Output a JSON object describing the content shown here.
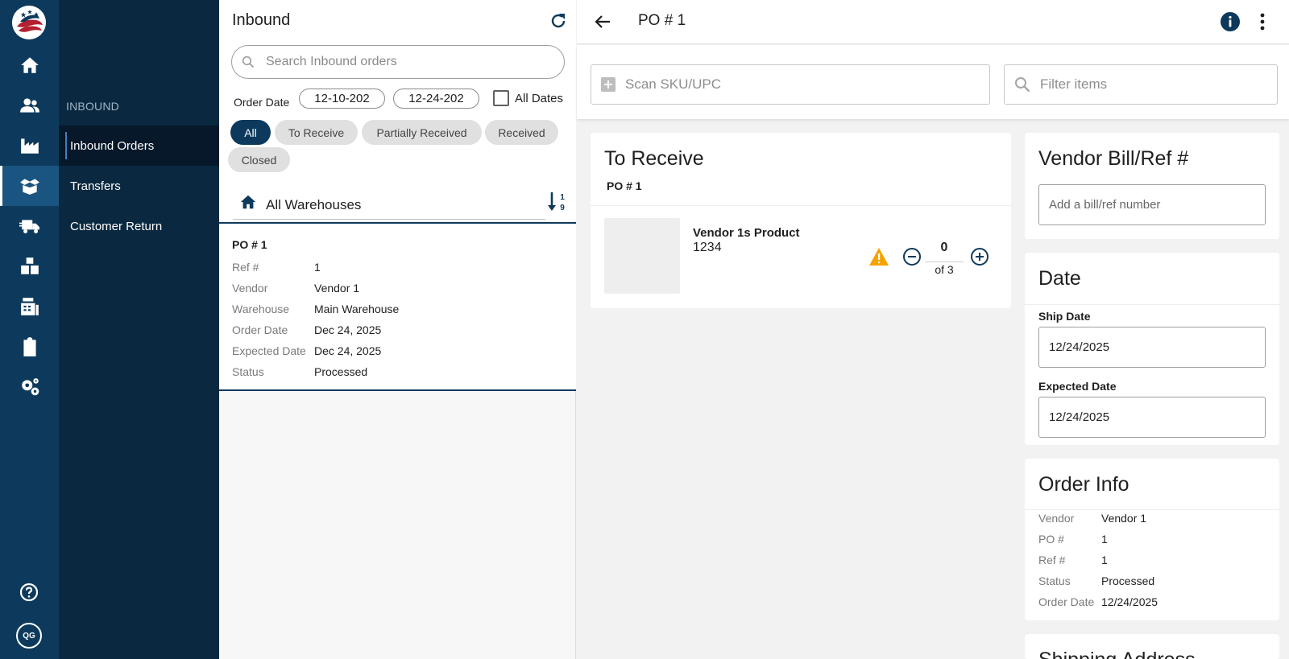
{
  "rail": {
    "items": [
      {
        "name": "home",
        "active": false
      },
      {
        "name": "customers",
        "active": false
      },
      {
        "name": "reports",
        "active": false
      },
      {
        "name": "inbound",
        "active": true
      },
      {
        "name": "shipping",
        "active": false
      },
      {
        "name": "inventory",
        "active": false
      },
      {
        "name": "billing",
        "active": false
      },
      {
        "name": "tasks",
        "active": false
      },
      {
        "name": "settings",
        "active": false
      }
    ],
    "avatar_initials": "QG",
    "active_color": "#1a5480",
    "bg_color": "#0d3a5c"
  },
  "subnav": {
    "section_label": "INBOUND",
    "items": [
      {
        "label": "Inbound Orders",
        "active": true
      },
      {
        "label": "Transfers",
        "active": false
      },
      {
        "label": "Customer Return",
        "active": false
      }
    ]
  },
  "list": {
    "title": "Inbound",
    "search_placeholder": "Search Inbound orders",
    "date_label": "Order Date",
    "date_from": "12-10-202",
    "date_to": "12-24-202",
    "all_dates_label": "All Dates",
    "all_dates_checked": false,
    "filters": [
      {
        "label": "All",
        "active": true
      },
      {
        "label": "To Receive",
        "active": false
      },
      {
        "label": "Partially Received",
        "active": false
      },
      {
        "label": "Received",
        "active": false
      },
      {
        "label": "Closed",
        "active": false
      }
    ],
    "warehouse_label": "All Warehouses",
    "orders": [
      {
        "po": "PO # 1",
        "fields": [
          {
            "k": "Ref #",
            "v": "1"
          },
          {
            "k": "Vendor",
            "v": "Vendor 1"
          },
          {
            "k": "Warehouse",
            "v": "Main Warehouse"
          },
          {
            "k": "Order Date",
            "v": "Dec 24, 2025"
          },
          {
            "k": "Expected Date",
            "v": "Dec 24, 2025"
          },
          {
            "k": "Status",
            "v": "Processed"
          }
        ]
      }
    ]
  },
  "detail": {
    "title": "PO # 1",
    "scan_placeholder": "Scan SKU/UPC",
    "filter_placeholder": "Filter items",
    "receive": {
      "title": "To Receive",
      "po": "PO # 1",
      "items": [
        {
          "name": "Vendor 1s Product",
          "sku": "1234",
          "qty": "0",
          "of": "of 3",
          "warning": true
        }
      ]
    },
    "vendor_bill": {
      "title": "Vendor Bill/Ref #",
      "placeholder": "Add a bill/ref number",
      "value": ""
    },
    "date": {
      "title": "Date",
      "ship_label": "Ship Date",
      "ship_value": "12/24/2025",
      "expected_label": "Expected Date",
      "expected_value": "12/24/2025"
    },
    "order_info": {
      "title": "Order Info",
      "fields": [
        {
          "k": "Vendor",
          "v": "Vendor 1"
        },
        {
          "k": "PO #",
          "v": "1"
        },
        {
          "k": "Ref #",
          "v": "1"
        },
        {
          "k": "Status",
          "v": "Processed"
        },
        {
          "k": "Order Date",
          "v": "12/24/2025"
        }
      ]
    },
    "shipping_address": {
      "title": "Shipping Address"
    }
  },
  "colors": {
    "accent": "#0d3a5c",
    "warning": "#f5a300",
    "chip": "#e0e0e0"
  }
}
